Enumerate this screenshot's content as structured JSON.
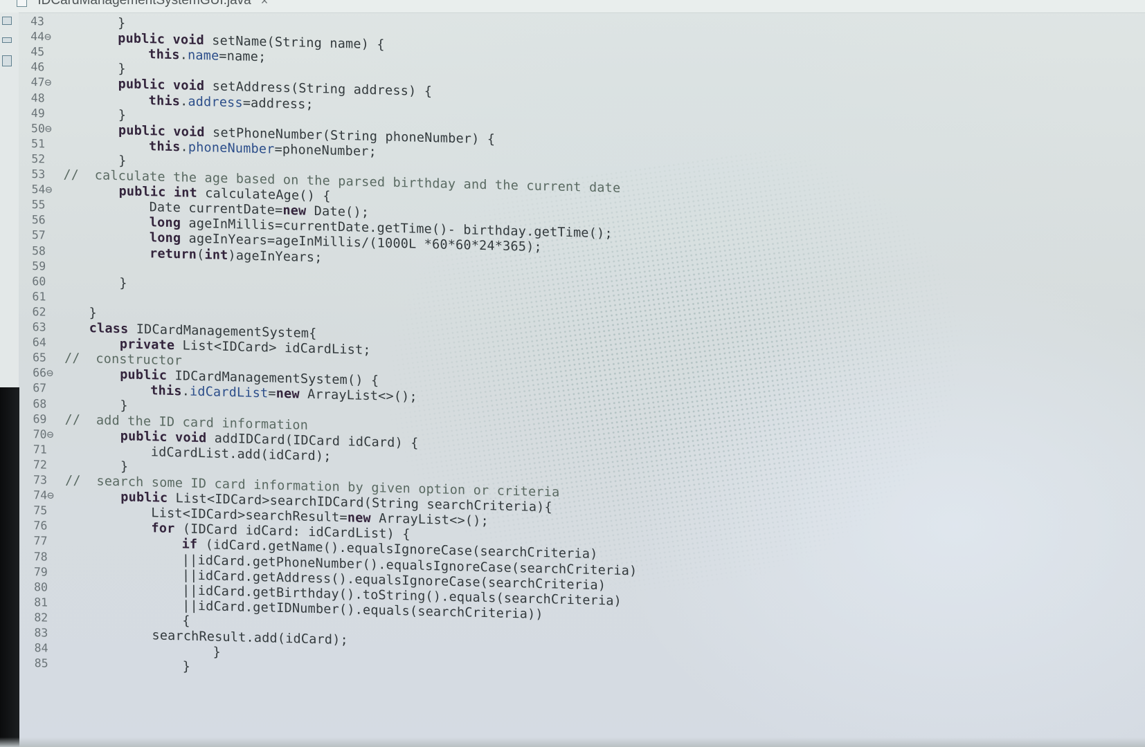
{
  "tab": {
    "title": "*IDCardManagementSystemGUI.java",
    "close_glyph": "×",
    "file_icon": "java-file-icon",
    "close_icon": "close-icon"
  },
  "colors": {
    "background": "#dde3e3",
    "code_text": "#333a3d",
    "keyword": "#33243c",
    "field": "#2c4e8a",
    "line_number": "#6a7377"
  },
  "lines": [
    {
      "n": "43",
      "indent": 2,
      "code": "}"
    },
    {
      "n": "44⊖",
      "indent": 2,
      "code": "public void setName(String name) {",
      "kw": [
        "public",
        "void"
      ]
    },
    {
      "n": "45",
      "indent": 4,
      "code": "this.name=name;",
      "kw": [
        "this"
      ],
      "fld": [
        "name"
      ]
    },
    {
      "n": "46",
      "indent": 2,
      "code": "}"
    },
    {
      "n": "47⊖",
      "indent": 2,
      "code": "public void setAddress(String address) {",
      "kw": [
        "public",
        "void"
      ]
    },
    {
      "n": "48",
      "indent": 4,
      "code": "this.address=address;",
      "kw": [
        "this"
      ],
      "fld": [
        "address"
      ]
    },
    {
      "n": "49",
      "indent": 2,
      "code": "}"
    },
    {
      "n": "50⊖",
      "indent": 2,
      "code": "public void setPhoneNumber(String phoneNumber) {",
      "kw": [
        "public",
        "void"
      ]
    },
    {
      "n": "51",
      "indent": 4,
      "code": "this.phoneNumber=phoneNumber;",
      "kw": [
        "this"
      ],
      "fld": [
        "phoneNumber"
      ]
    },
    {
      "n": "52",
      "indent": 2,
      "code": "}"
    },
    {
      "n": "53",
      "indent": 0,
      "code": "//  calculate the age based on the parsed birthday and the current date"
    },
    {
      "n": "54⊖",
      "indent": 2,
      "code": "public int calculateAge() {",
      "kw": [
        "public",
        "int"
      ]
    },
    {
      "n": "55",
      "indent": 4,
      "code": "Date currentDate=new Date();",
      "kw": [
        "new"
      ]
    },
    {
      "n": "56",
      "indent": 4,
      "code": "long ageInMillis=currentDate.getTime()- birthday.getTime();",
      "kw": [
        "long"
      ]
    },
    {
      "n": "57",
      "indent": 4,
      "code": "long ageInYears=ageInMillis/(1000L *60*60*24*365);",
      "kw": [
        "long"
      ]
    },
    {
      "n": "58",
      "indent": 4,
      "code": "return(int)ageInYears;",
      "kw": [
        "return",
        "int"
      ]
    },
    {
      "n": "59",
      "indent": 0,
      "code": ""
    },
    {
      "n": "60",
      "indent": 2,
      "code": "}"
    },
    {
      "n": "61",
      "indent": 0,
      "code": ""
    },
    {
      "n": "62",
      "indent": 0,
      "code": "}"
    },
    {
      "n": "63",
      "indent": 0,
      "code": "class IDCardManagementSystem{",
      "kw": [
        "class"
      ]
    },
    {
      "n": "64",
      "indent": 2,
      "code": "private List<IDCard> idCardList;",
      "kw": [
        "private"
      ],
      "fld": [
        "idCardList"
      ]
    },
    {
      "n": "65",
      "indent": 0,
      "code": "//  constructor"
    },
    {
      "n": "66⊖",
      "indent": 2,
      "code": "public IDCardManagementSystem() {",
      "kw": [
        "public"
      ]
    },
    {
      "n": "67",
      "indent": 4,
      "code": "this.idCardList=new ArrayList<>();",
      "kw": [
        "this",
        "new"
      ],
      "fld": [
        "idCardList"
      ]
    },
    {
      "n": "68",
      "indent": 2,
      "code": "}"
    },
    {
      "n": "69",
      "indent": 0,
      "code": "//  add the ID card information"
    },
    {
      "n": "70⊖",
      "indent": 2,
      "code": "public void addIDCard(IDCard idCard) {",
      "kw": [
        "public",
        "void"
      ]
    },
    {
      "n": "71",
      "indent": 4,
      "code": "idCardList.add(idCard);"
    },
    {
      "n": "72",
      "indent": 2,
      "code": "}"
    },
    {
      "n": "73",
      "indent": 0,
      "code": "//  search some ID card information by given option or criteria"
    },
    {
      "n": "74⊖",
      "indent": 2,
      "code": "public List<IDCard>searchIDCard(String searchCriteria){",
      "kw": [
        "public"
      ]
    },
    {
      "n": "75",
      "indent": 4,
      "code": "List<IDCard>searchResult=new ArrayList<>();",
      "kw": [
        "new"
      ]
    },
    {
      "n": "76",
      "indent": 4,
      "code": "for (IDCard idCard: idCardList) {",
      "kw": [
        "for"
      ]
    },
    {
      "n": "77",
      "indent": 6,
      "code": "if (idCard.getName().equalsIgnoreCase(searchCriteria)",
      "kw": [
        "if"
      ]
    },
    {
      "n": "78",
      "indent": 6,
      "code": "||idCard.getPhoneNumber().equalsIgnoreCase(searchCriteria)"
    },
    {
      "n": "79",
      "indent": 6,
      "code": "||idCard.getAddress().equalsIgnoreCase(searchCriteria)"
    },
    {
      "n": "80",
      "indent": 6,
      "code": "||idCard.getBirthday().toString().equals(searchCriteria)"
    },
    {
      "n": "81",
      "indent": 6,
      "code": "||idCard.getIDNumber().equals(searchCriteria))"
    },
    {
      "n": "82",
      "indent": 6,
      "code": "{"
    },
    {
      "n": "83",
      "indent": 4,
      "code": "searchResult.add(idCard);"
    },
    {
      "n": "84",
      "indent": 8,
      "code": "}"
    },
    {
      "n": "85",
      "indent": 6,
      "code": "}"
    }
  ]
}
